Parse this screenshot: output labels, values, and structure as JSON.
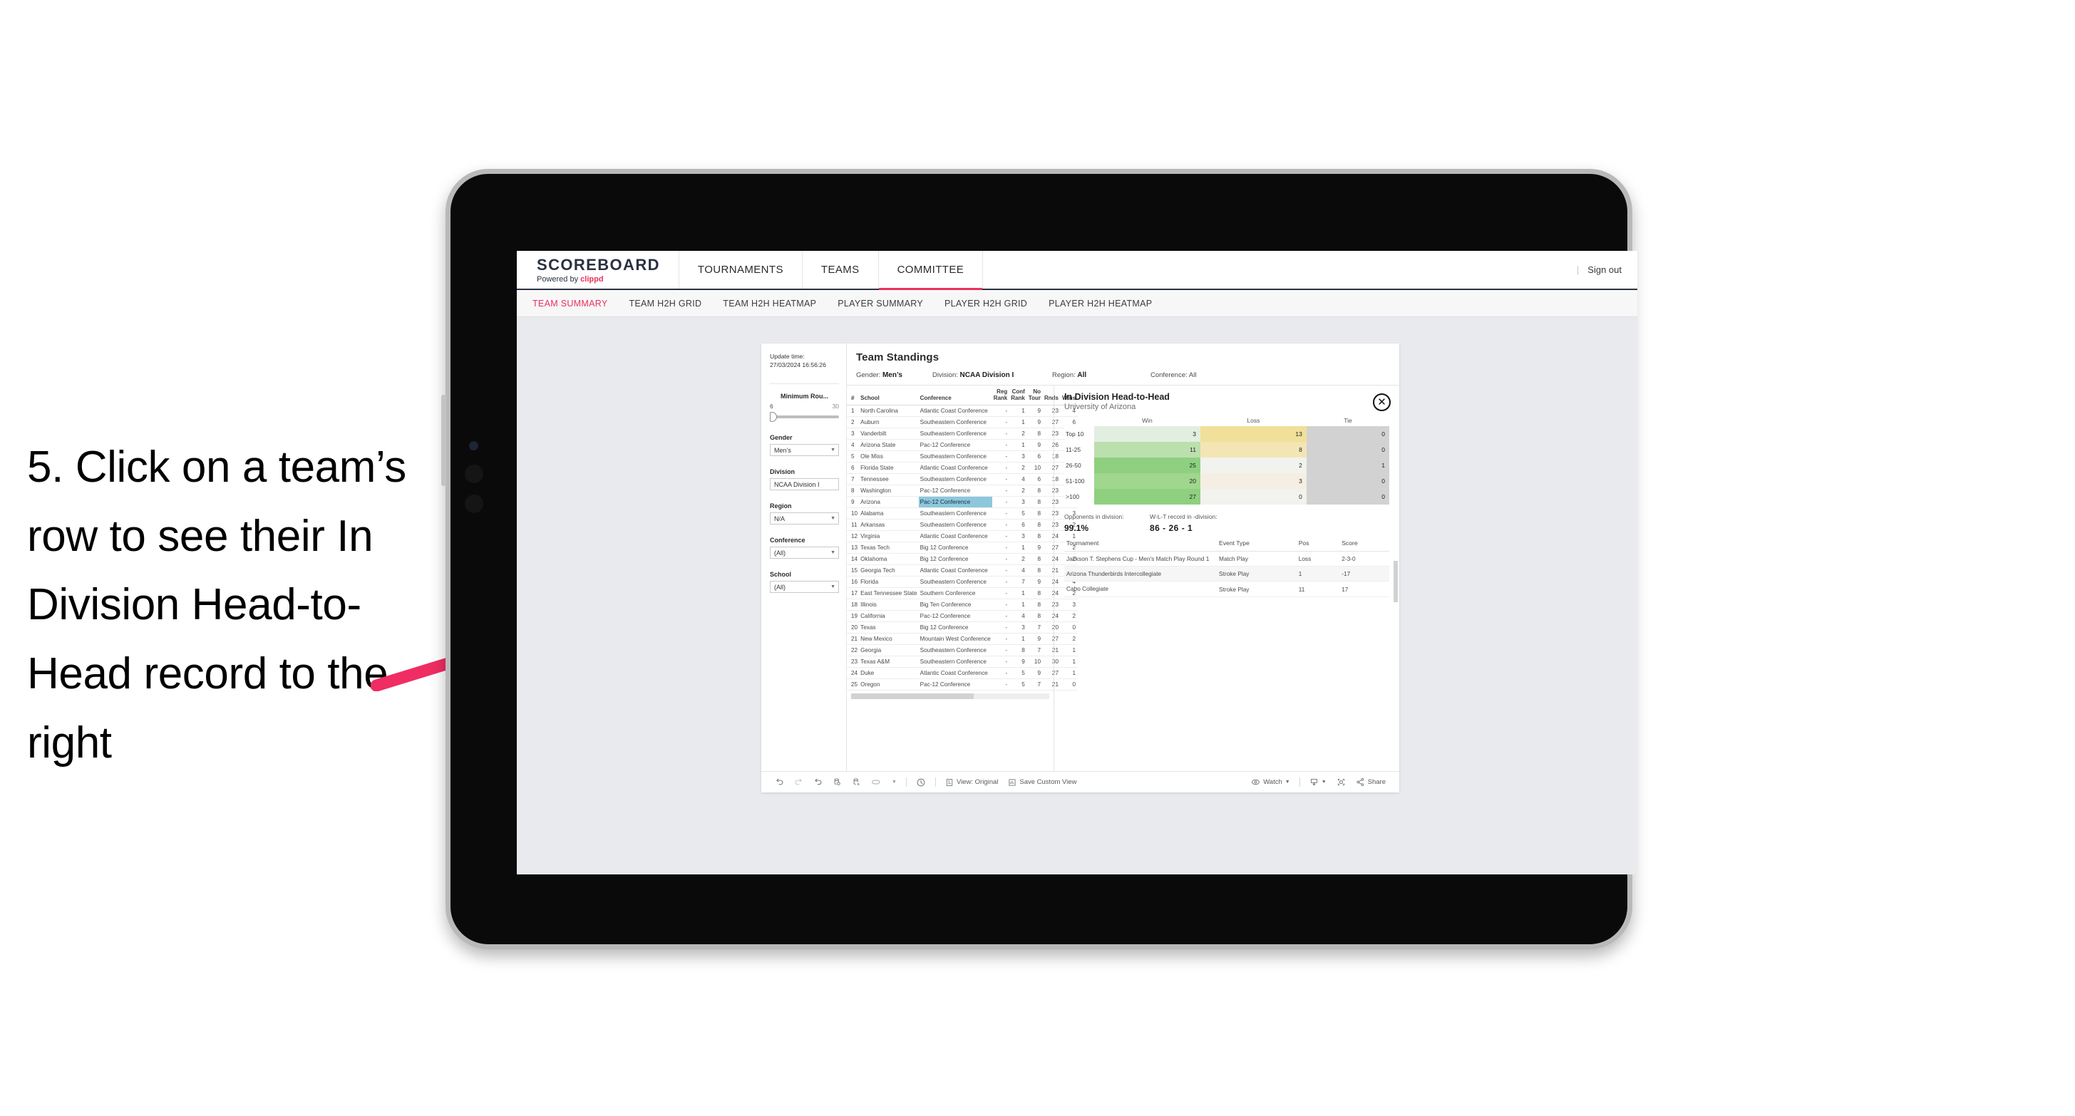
{
  "instruction": "5. Click on a team’s row to see their In Division Head-to-Head record to the right",
  "accent": {
    "pink": "#e8325c",
    "arrow": "#ef2d63",
    "navy": "#2a3142",
    "highlight": "#8dc7dd"
  },
  "topnav": {
    "brand_title": "SCOREBOARD",
    "brand_prefix": "Powered by ",
    "brand_name": "clippd",
    "items": [
      "TOURNAMENTS",
      "TEAMS",
      "COMMITTEE"
    ],
    "active": "COMMITTEE",
    "separator": "|",
    "signout": "Sign out"
  },
  "subnav": {
    "items": [
      "TEAM SUMMARY",
      "TEAM H2H GRID",
      "TEAM H2H HEATMAP",
      "PLAYER SUMMARY",
      "PLAYER H2H GRID",
      "PLAYER H2H HEATMAP"
    ],
    "active": "TEAM SUMMARY"
  },
  "filters": {
    "update_label": "Update time:",
    "update_value": "27/03/2024 16:56:26",
    "slider": {
      "label": "Minimum Rou...",
      "min": "6",
      "max": "30"
    },
    "groups": [
      {
        "label": "Gender",
        "value": "Men’s"
      },
      {
        "label": "Division",
        "value": "NCAA Division I"
      },
      {
        "label": "Region",
        "value": "N/A"
      },
      {
        "label": "Conference",
        "value": "(All)"
      },
      {
        "label": "School",
        "value": "(All)"
      }
    ]
  },
  "viz": {
    "title": "Team Standings",
    "summary": [
      {
        "label": "Gender:",
        "value": "Men’s"
      },
      {
        "label": "Division:",
        "value": "NCAA Division I"
      },
      {
        "label": "Region:",
        "value": "All"
      },
      {
        "label": "Conference:",
        "value": "All"
      }
    ]
  },
  "standings": {
    "headers": [
      "#",
      "School",
      "Conference",
      "Reg Rank",
      "Conf Rank",
      "No Tour",
      "Rnds",
      "Wins"
    ],
    "selected_row_index": 8,
    "rows": [
      [
        "1",
        "North Carolina",
        "Atlantic Coast Conference",
        "-",
        "1",
        "9",
        "23",
        "4"
      ],
      [
        "2",
        "Auburn",
        "Southeastern Conference",
        "-",
        "1",
        "9",
        "27",
        "6"
      ],
      [
        "3",
        "Vanderbilt",
        "Southeastern Conference",
        "-",
        "2",
        "8",
        "23",
        "5"
      ],
      [
        "4",
        "Arizona State",
        "Pac-12 Conference",
        "-",
        "1",
        "9",
        "26",
        "1"
      ],
      [
        "5",
        "Ole Miss",
        "Southeastern Conference",
        "-",
        "3",
        "6",
        "18",
        "1"
      ],
      [
        "6",
        "Florida State",
        "Atlantic Coast Conference",
        "-",
        "2",
        "10",
        "27",
        "3"
      ],
      [
        "7",
        "Tennessee",
        "Southeastern Conference",
        "-",
        "4",
        "6",
        "18",
        "2"
      ],
      [
        "8",
        "Washington",
        "Pac-12 Conference",
        "-",
        "2",
        "8",
        "23",
        "1"
      ],
      [
        "9",
        "Arizona",
        "Pac-12 Conference",
        "-",
        "3",
        "8",
        "23",
        "2"
      ],
      [
        "10",
        "Alabama",
        "Southeastern Conference",
        "-",
        "5",
        "8",
        "23",
        "3"
      ],
      [
        "11",
        "Arkansas",
        "Southeastern Conference",
        "-",
        "6",
        "8",
        "23",
        "2"
      ],
      [
        "12",
        "Virginia",
        "Atlantic Coast Conference",
        "-",
        "3",
        "8",
        "24",
        "1"
      ],
      [
        "13",
        "Texas Tech",
        "Big 12 Conference",
        "-",
        "1",
        "9",
        "27",
        "2"
      ],
      [
        "14",
        "Oklahoma",
        "Big 12 Conference",
        "-",
        "2",
        "8",
        "24",
        "2"
      ],
      [
        "15",
        "Georgia Tech",
        "Atlantic Coast Conference",
        "-",
        "4",
        "8",
        "21",
        "0"
      ],
      [
        "16",
        "Florida",
        "Southeastern Conference",
        "-",
        "7",
        "9",
        "24",
        "4"
      ],
      [
        "17",
        "East Tennessee State",
        "Southern Conference",
        "-",
        "1",
        "8",
        "24",
        "2"
      ],
      [
        "18",
        "Illinois",
        "Big Ten Conference",
        "-",
        "1",
        "8",
        "23",
        "3"
      ],
      [
        "19",
        "California",
        "Pac-12 Conference",
        "-",
        "4",
        "8",
        "24",
        "2"
      ],
      [
        "20",
        "Texas",
        "Big 12 Conference",
        "-",
        "3",
        "7",
        "20",
        "0"
      ],
      [
        "21",
        "New Mexico",
        "Mountain West Conference",
        "-",
        "1",
        "9",
        "27",
        "2"
      ],
      [
        "22",
        "Georgia",
        "Southeastern Conference",
        "-",
        "8",
        "7",
        "21",
        "1"
      ],
      [
        "23",
        "Texas A&M",
        "Southeastern Conference",
        "-",
        "9",
        "10",
        "30",
        "1"
      ],
      [
        "24",
        "Duke",
        "Atlantic Coast Conference",
        "-",
        "5",
        "9",
        "27",
        "1"
      ],
      [
        "25",
        "Oregon",
        "Pac-12 Conference",
        "-",
        "5",
        "7",
        "21",
        "0"
      ]
    ]
  },
  "detail": {
    "title": "In Division Head-to-Head",
    "subtitle": "University of Arizona",
    "close_icon": "✕",
    "opponents_label": "Opponents in division:",
    "opponents_value": "99.1%",
    "record_label": "W-L-T record in -division:",
    "record_value": "86 - 26 - 1",
    "tournaments_headers": [
      "Tournament",
      "Event Type",
      "Pos",
      "Score"
    ],
    "tournaments": [
      [
        "Jackson T. Stephens Cup - Men’s Match Play Round 1",
        "Match Play",
        "Loss",
        "2-3-0"
      ],
      [
        "Arizona Thunderbirds Intercollegiate",
        "Stroke Play",
        "1",
        "-17"
      ],
      [
        "Cabo Collegiate",
        "Stroke Play",
        "11",
        "17"
      ]
    ]
  },
  "chart_data": {
    "type": "heatmap",
    "title": "In Division Head-to-Head",
    "subtitle": "University of Arizona",
    "columns": [
      "Win",
      "Loss",
      "Tie"
    ],
    "rows": [
      "Top 10",
      "11-25",
      "26-50",
      "51-100",
      ">100"
    ],
    "values": [
      [
        3,
        13,
        0
      ],
      [
        11,
        8,
        0
      ],
      [
        25,
        2,
        1
      ],
      [
        20,
        3,
        0
      ],
      [
        27,
        0,
        0
      ]
    ],
    "cell_colors": [
      [
        "#e2efe0",
        "#f0e09a",
        "#d2d2d2"
      ],
      [
        "#bcdfae",
        "#f3e6b4",
        "#d2d2d2"
      ],
      [
        "#8ed07f",
        "#f2f2ee",
        "#d2d2d2"
      ],
      [
        "#a0d68e",
        "#f4efe2",
        "#d2d2d2"
      ],
      [
        "#8ed07f",
        "#f2f2ee",
        "#d2d2d2"
      ]
    ]
  },
  "toolbar": {
    "icons_left": [
      "undo-icon",
      "redo-icon",
      "revert-icon",
      "refresh-data-icon",
      "pause-icon",
      "device-icon",
      "chevron-down-icon"
    ],
    "clock_icon": "history-icon",
    "view_label": "View: Original",
    "save_label": "Save Custom View",
    "watch_label": "Watch",
    "share_label": "Share"
  }
}
